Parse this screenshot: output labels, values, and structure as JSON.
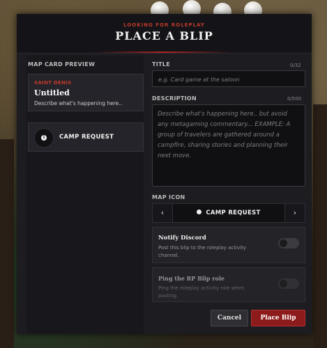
{
  "header": {
    "kicker": "LOOKING FOR ROLEPLAY",
    "title": "PLACE A BLIP"
  },
  "preview": {
    "section_label": "MAP CARD PREVIEW",
    "location": "SAINT DENIS",
    "card_title": "Untitled",
    "card_description": "Describe what's happening here..",
    "category_label": "CAMP REQUEST",
    "category_icon": "info-dot-icon"
  },
  "title_field": {
    "label": "TITLE",
    "counter": "0/32",
    "placeholder": "e.g. Card game at the saloon",
    "value": ""
  },
  "description_field": {
    "label": "DESCRIPTION",
    "counter": "0/500",
    "placeholder": "Describe what's happening here.. but avoid any metagaming commentary... EXAMPLE: A group of travelers are gathered around a campfire, sharing stories and planning their next move.",
    "value": ""
  },
  "map_icon": {
    "label": "MAP ICON",
    "selected": "CAMP REQUEST",
    "prev_glyph": "‹",
    "next_glyph": "›"
  },
  "notify_discord": {
    "title": "Notify Discord",
    "description": "Post this blip to the roleplay activity channel.",
    "enabled": false
  },
  "ping_role": {
    "title": "Ping the RP Blip role",
    "description": "Ping the roleplay activity role when posting.",
    "enabled": false,
    "disabled": true
  },
  "buttons": {
    "cancel": "Cancel",
    "place": "Place Blip"
  },
  "colors": {
    "accent_red": "#c0392b",
    "primary_button": "#8e1b1b",
    "panel_bg": "#1c1c21"
  }
}
